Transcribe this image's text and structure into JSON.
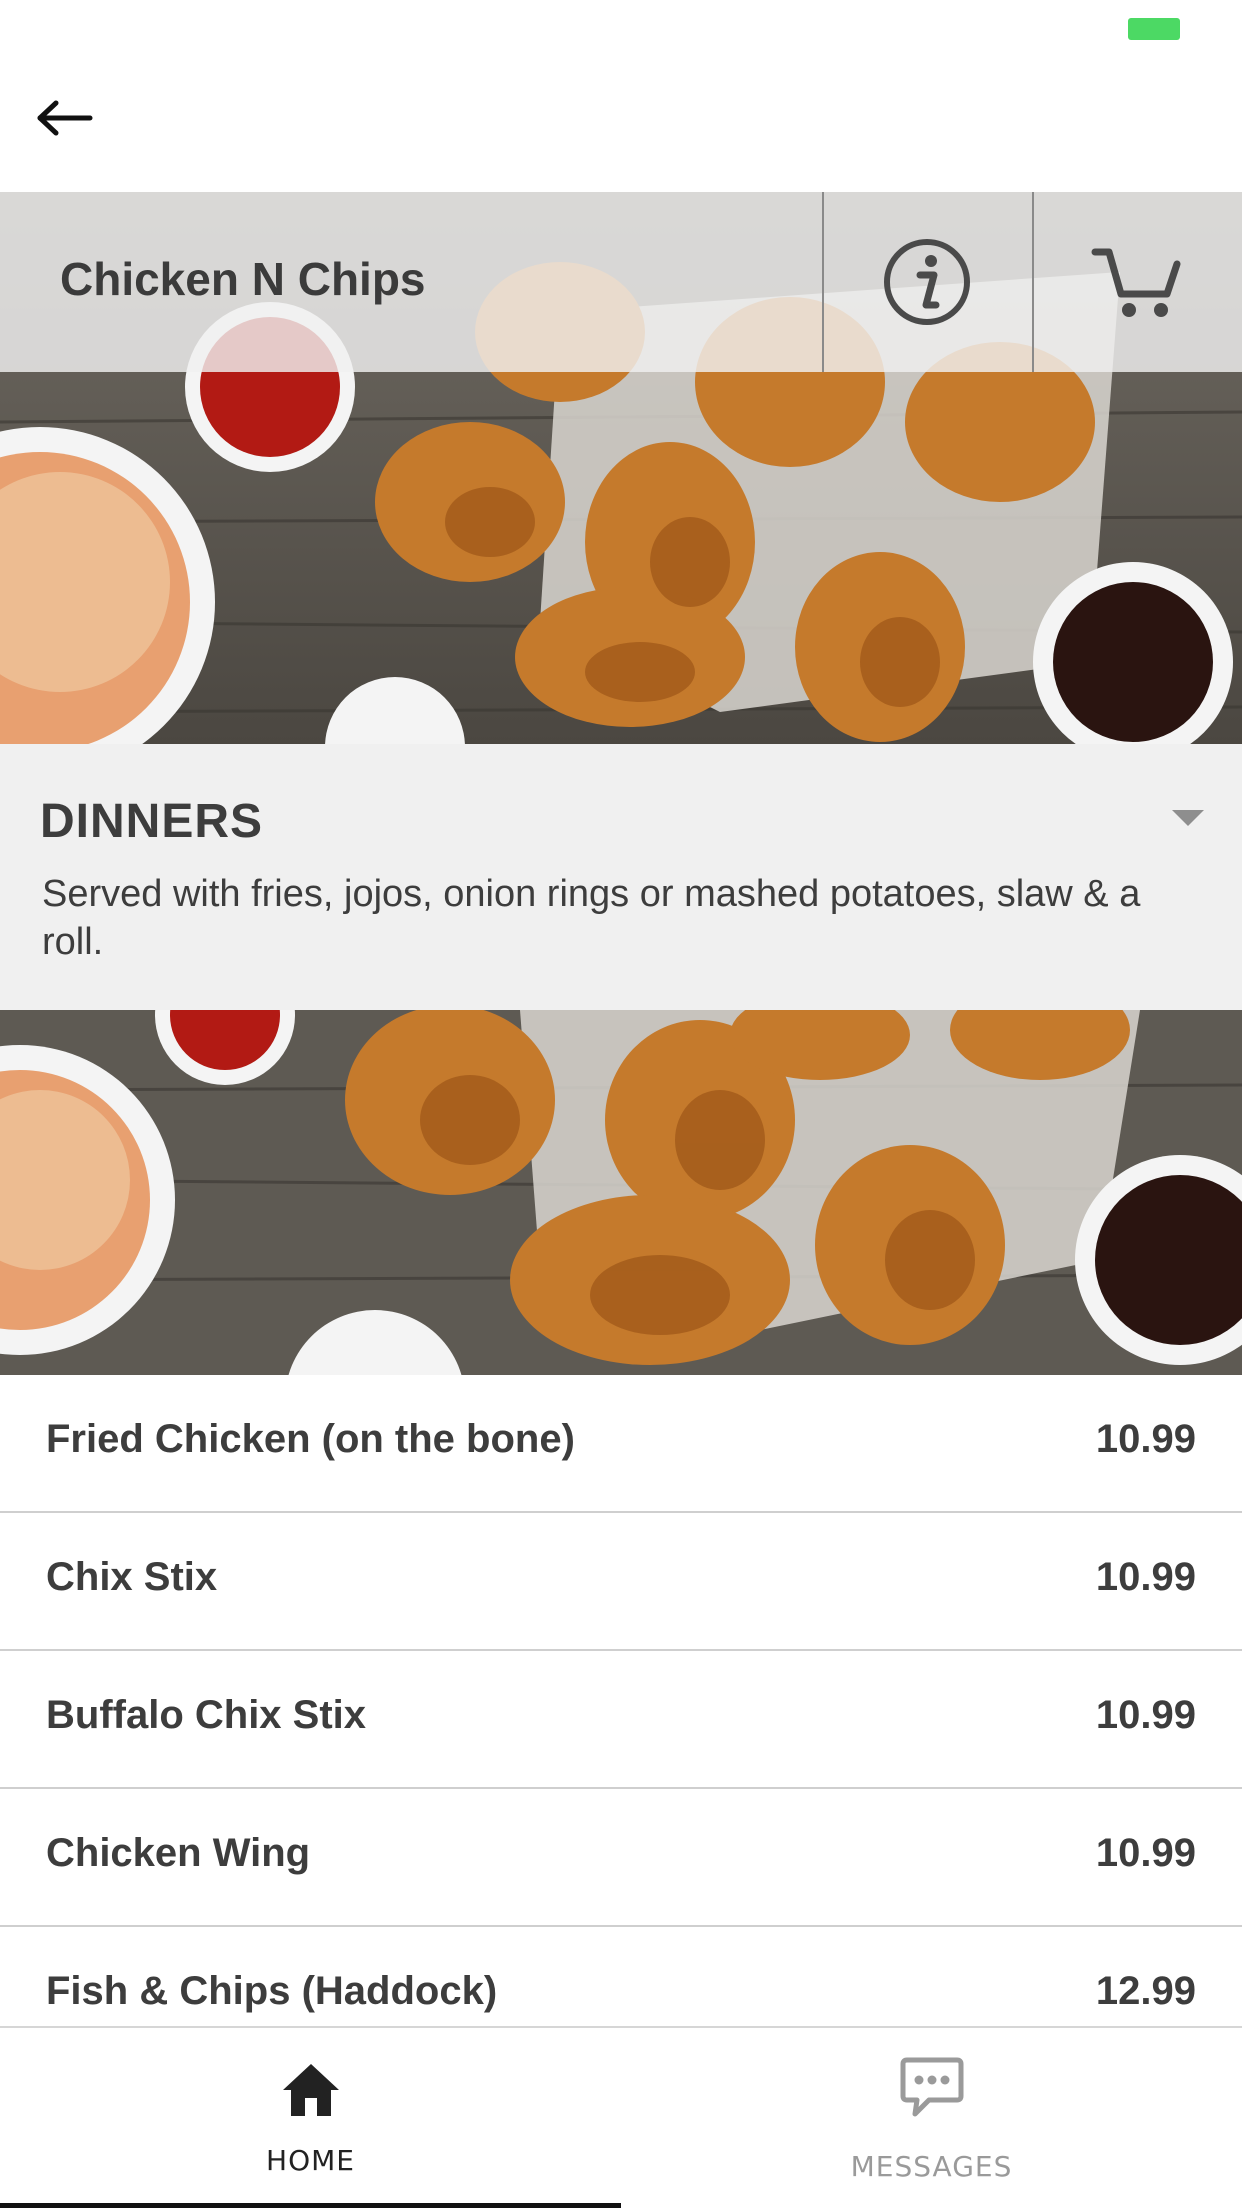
{
  "status_bar": {
    "battery_color": "#4cd964"
  },
  "nav": {
    "back_icon": "arrow-left-icon"
  },
  "store": {
    "name": "Chicken N Chips",
    "info_icon": "info-icon",
    "cart_icon": "cart-icon"
  },
  "category": {
    "title": "DINNERS",
    "description": "Served with fries, jojos, onion rings or mashed potatoes, slaw & a roll.",
    "toggle_icon": "caret-down-icon"
  },
  "menu_items": [
    {
      "name": "Fried Chicken (on the bone)",
      "price": "10.99"
    },
    {
      "name": "Chix Stix",
      "price": "10.99"
    },
    {
      "name": "Buffalo Chix Stix",
      "price": "10.99"
    },
    {
      "name": "Chicken Wing",
      "price": "10.99"
    },
    {
      "name": "Fish & Chips (Haddock)",
      "price": "12.99"
    }
  ],
  "tabs": [
    {
      "label": "HOME",
      "icon": "home-icon",
      "active": true
    },
    {
      "label": "MESSAGES",
      "icon": "chat-bubble-icon",
      "active": false
    }
  ],
  "colors": {
    "accent_active_tab": "#111111",
    "inactive_tab": "#9a9a9a",
    "category_bg": "#f0f0f0"
  }
}
